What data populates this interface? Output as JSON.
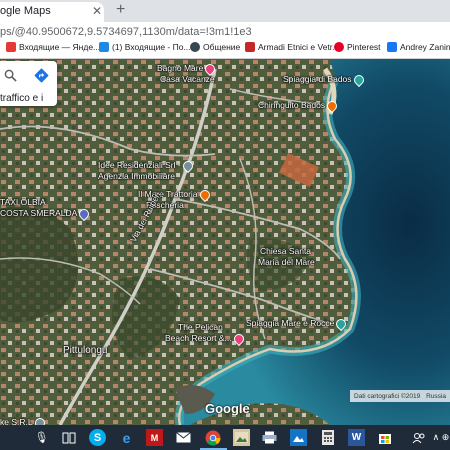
{
  "browser": {
    "tab_title": "ogle Maps",
    "tab_close": "✕",
    "new_tab": "+",
    "url": "ps/@40.9500672,9.5734697,1130m/data=!3m1!1e3"
  },
  "bookmarks": [
    {
      "label": "Входящие — Янде...",
      "icon": "mail-icon",
      "color": "#e53935"
    },
    {
      "label": "(1) Входящие - По...",
      "icon": "mail-icon",
      "color": "#1e88e5"
    },
    {
      "label": "Общение",
      "icon": "chat-icon",
      "color": "#37474f"
    },
    {
      "label": "Armadi Etnici e Vetr...",
      "icon": "furniture-icon",
      "color": "#c62828"
    },
    {
      "label": "Pinterest",
      "icon": "pinterest-icon",
      "color": "#e60023"
    },
    {
      "label": "Andrey Zanin",
      "icon": "facebook-icon",
      "color": "#1877f2"
    }
  ],
  "map": {
    "search_text": "traffico e i",
    "labels": {
      "bagno": "Bagno Mare",
      "casa": "Casa Vacanze",
      "spiaggia_bados": "Spiaggia di Bados",
      "chiringuito": "Chiringuito Bados",
      "idee1": "Idee Residenziali Srl -",
      "idee2": "Agenzia Immobiliare",
      "ilmare1": "Il Mare Trattoria",
      "ilmare2": "Pescheria",
      "taxi1": "TAXI OLBIA",
      "taxi2": "COSTA SMERALDA",
      "via": "Via dei Ruiperi",
      "chiesa1": "Chiesa Santa",
      "chiesa2": "Maria del Mare",
      "spiaggia_corse": "Spiaggia Mare e Rocce",
      "pelican1": "The Pelican",
      "pelican2": "Beach Resort &...",
      "pittulongu": "Pittulongu",
      "ks": "ke S.R.L"
    },
    "google_logo": "Google",
    "attribution_data": "Dati cartografici ©2019",
    "attribution_region": "Russia"
  },
  "taskbar": {
    "items": [
      "microphone-icon",
      "task-view-icon",
      "skype-icon",
      "edge-icon",
      "mcafee-icon",
      "mail-icon",
      "chrome-icon",
      "image-viewer-icon",
      "printer-icon",
      "photos-icon",
      "calculator-icon",
      "word-icon",
      "store-icon",
      "people-icon"
    ],
    "tray": "∧ ⊕"
  },
  "colors": {
    "sea_deep": "#0d3a55",
    "sea_shallow": "#3fa6b2",
    "land": "#4a5a3a",
    "sand": "#d9cfb0"
  }
}
